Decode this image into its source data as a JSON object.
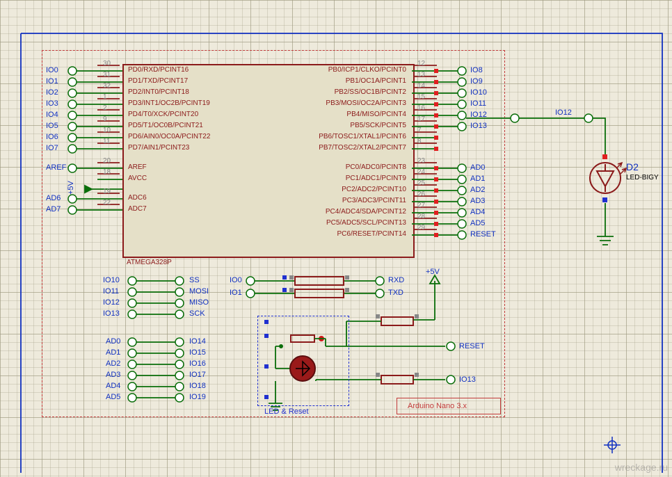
{
  "chip_ref": "ATMEGA328P",
  "module_name": "Arduino Nano 3.x",
  "subckt": "LED & Reset",
  "led": {
    "ref": "D2",
    "part": "LED-BIGY"
  },
  "power": "+5V",
  "watermark": "wreckage.ru",
  "pins_left": [
    {
      "num": "30",
      "func": "PD0/RXD/PCINT16",
      "net": "IO0"
    },
    {
      "num": "31",
      "func": "PD1/TXD/PCINT17",
      "net": "IO1"
    },
    {
      "num": "32",
      "func": "PD2/INT0/PCINT18",
      "net": "IO2"
    },
    {
      "num": "1",
      "func": "PD3/INT1/OC2B/PCINT19",
      "net": "IO3"
    },
    {
      "num": "2",
      "func": "PD4/T0/XCK/PCINT20",
      "net": "IO4"
    },
    {
      "num": "9",
      "func": "PD5/T1/OC0B/PCINT21",
      "net": "IO5"
    },
    {
      "num": "10",
      "func": "PD6/AIN0/OC0A/PCINT22",
      "net": "IO6"
    },
    {
      "num": "11",
      "func": "PD7/AIN1/PCINT23",
      "net": "IO7"
    },
    {
      "num": "20",
      "func": "AREF",
      "net": "AREF"
    },
    {
      "num": "18",
      "func": "AVCC",
      "net": ""
    },
    {
      "num": "19",
      "func": "ADC6",
      "net": "AD6"
    },
    {
      "num": "22",
      "func": "ADC7",
      "net": "AD7"
    }
  ],
  "pins_right": [
    {
      "num": "12",
      "func": "PB0/ICP1/CLKO/PCINT0",
      "net": "IO8"
    },
    {
      "num": "13",
      "func": "PB1/OC1A/PCINT1",
      "net": "IO9"
    },
    {
      "num": "14",
      "func": "PB2/SS/OC1B/PCINT2",
      "net": "IO10"
    },
    {
      "num": "15",
      "func": "PB3/MOSI/OC2A/PCINT3",
      "net": "IO11"
    },
    {
      "num": "16",
      "func": "PB4/MISO/PCINT4",
      "net": "IO12"
    },
    {
      "num": "17",
      "func": "PB5/SCK/PCINT5",
      "net": "IO13"
    },
    {
      "num": "7",
      "func": "PB6/TOSC1/XTAL1/PCINT6",
      "net": ""
    },
    {
      "num": "8",
      "func": "PB7/TOSC2/XTAL2/PCINT7",
      "net": ""
    },
    {
      "num": "23",
      "func": "PC0/ADC0/PCINT8",
      "net": "AD0"
    },
    {
      "num": "24",
      "func": "PC1/ADC1/PCINT9",
      "net": "AD1"
    },
    {
      "num": "25",
      "func": "PC2/ADC2/PCINT10",
      "net": "AD2"
    },
    {
      "num": "26",
      "func": "PC3/ADC3/PCINT11",
      "net": "AD3"
    },
    {
      "num": "27",
      "func": "PC4/ADC4/SDA/PCINT12",
      "net": "AD4"
    },
    {
      "num": "28",
      "func": "PC5/ADC5/SCL/PCINT13",
      "net": "AD5"
    },
    {
      "num": "29",
      "func": "PC6/RESET/PCINT14",
      "net": "RESET"
    }
  ],
  "hdr_spi": [
    {
      "a": "IO10",
      "b": "SS"
    },
    {
      "a": "IO11",
      "b": "MOSI"
    },
    {
      "a": "IO12",
      "b": "MISO"
    },
    {
      "a": "IO13",
      "b": "SCK"
    }
  ],
  "hdr_ad": [
    {
      "a": "AD0",
      "b": "IO14"
    },
    {
      "a": "AD1",
      "b": "IO15"
    },
    {
      "a": "AD2",
      "b": "IO16"
    },
    {
      "a": "AD3",
      "b": "IO17"
    },
    {
      "a": "AD4",
      "b": "IO18"
    },
    {
      "a": "AD5",
      "b": "IO19"
    }
  ],
  "serial": [
    {
      "a": "IO0",
      "b": "RXD"
    },
    {
      "a": "IO1",
      "b": "TXD"
    }
  ],
  "reset_net": "RESET",
  "io13_net": "IO13",
  "io12_net": "IO12",
  "avcc_label": "+5V"
}
